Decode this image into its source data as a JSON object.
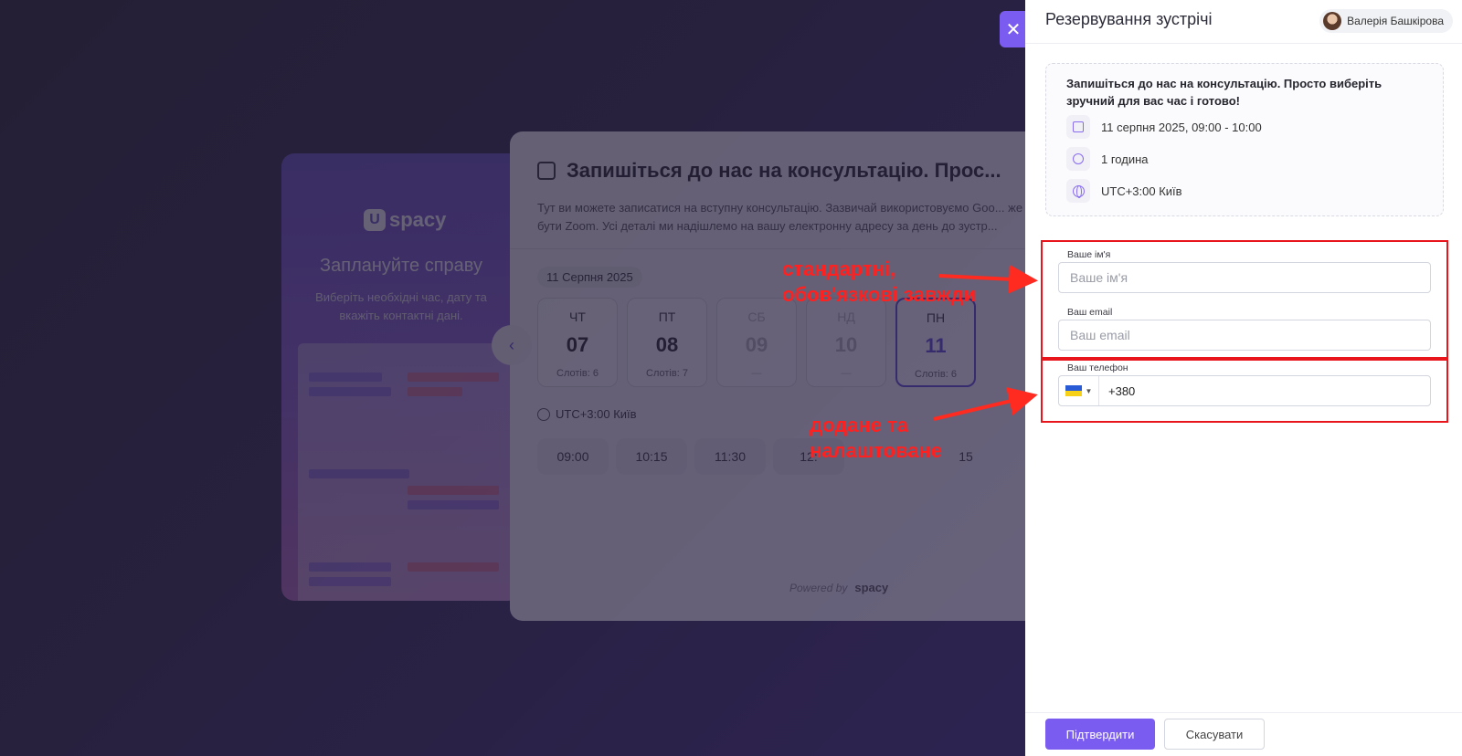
{
  "background": {
    "promo": {
      "logo": "spacy",
      "title": "Заплануйте справу",
      "subtitle": "Виберіть необхідні час, дату та вкажіть контактні дані."
    },
    "widget": {
      "title": "Запишіться до нас на консультацію. Прос...",
      "description": "Тут ви можете записатися на вступну консультацію. Зазвичай використовуємо Goo... же бути Zoom. Усі деталі ми надішлемо на вашу електронну адресу за день до зустр...",
      "date_chip": "11 Серпня 2025",
      "days": [
        {
          "name": "ЧТ",
          "num": "07",
          "slots": "Слотів: 6"
        },
        {
          "name": "ПТ",
          "num": "08",
          "slots": "Слотів: 7"
        },
        {
          "name": "СБ",
          "num": "09",
          "slots": "—"
        },
        {
          "name": "НД",
          "num": "10",
          "slots": "—"
        },
        {
          "name": "ПН",
          "num": "11",
          "slots": "Слотів: 6"
        }
      ],
      "timezone": "UTC+3:00 Київ",
      "slots": [
        "09:00",
        "10:15",
        "11:30",
        "12:",
        "15"
      ],
      "powered_by": "Powered by",
      "powered_logo": "spacy"
    }
  },
  "panel": {
    "title": "Резервування зустрічі",
    "user_name": "Валерія Башкірова",
    "info": {
      "text": "Запишіться до нас на консультацію. Просто виберіть зручний для вас час і готово!",
      "datetime": "11 серпня 2025, 09:00 - 10:00",
      "duration": "1 година",
      "timezone": "UTC+3:00 Київ"
    },
    "fields": {
      "name_label": "Ваше ім'я",
      "name_placeholder": "Ваше ім'я",
      "email_label": "Ваш email",
      "email_placeholder": "Ваш email",
      "phone_label": "Ваш телефон",
      "phone_value": "+380"
    },
    "buttons": {
      "confirm": "Підтвердити",
      "cancel": "Скасувати"
    }
  },
  "annotations": {
    "standard": [
      "стандартні,",
      "обов'язкові завжди"
    ],
    "added": [
      "додане та",
      "налаштоване"
    ],
    "color": "#e8161c"
  },
  "icons": [
    "close-icon",
    "calendar-icon",
    "clock-icon",
    "globe-icon",
    "ukraine-flag-icon",
    "chevron-left-icon"
  ],
  "colors": {
    "accent": "#7b5cf0",
    "annotation": "#e8161c"
  }
}
